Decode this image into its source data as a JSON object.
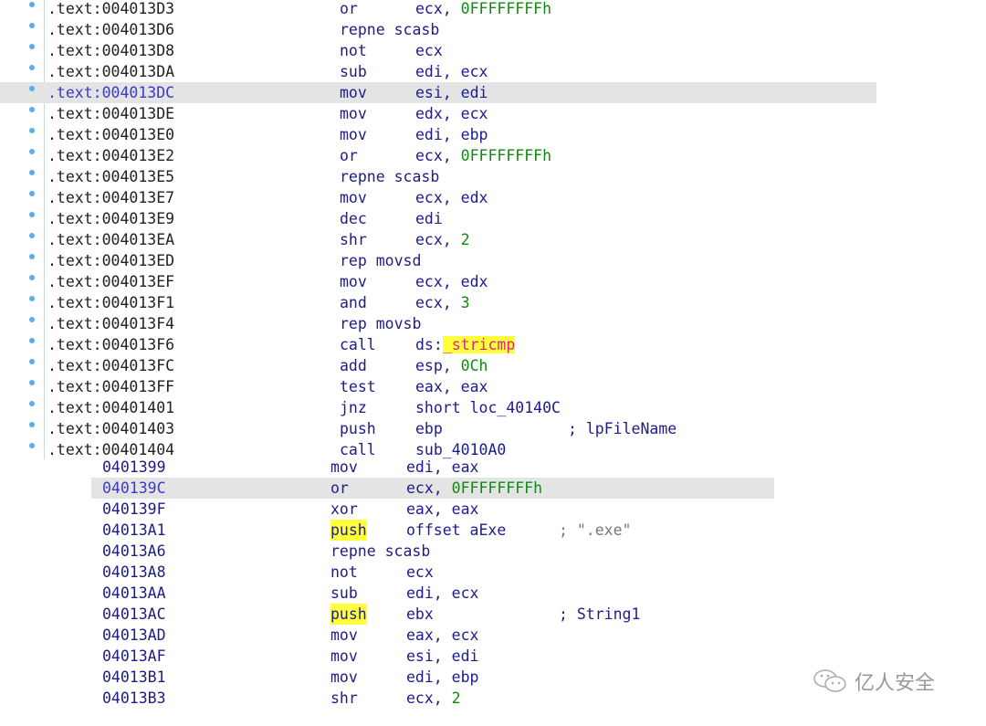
{
  "top_listing": [
    {
      "addr": ".text:004013D3",
      "mn": "or",
      "op": "ecx, ",
      "num": "0FFFFFFFFh",
      "partial": true
    },
    {
      "addr": ".text:004013D6",
      "mn": "repne scasb",
      "op": ""
    },
    {
      "addr": ".text:004013D8",
      "mn": "not",
      "op": "ecx"
    },
    {
      "addr": ".text:004013DA",
      "mn": "sub",
      "op": "edi, ecx"
    },
    {
      "addr": ".text:004013DC",
      "mn": "mov",
      "op": "esi, edi",
      "highlight": true
    },
    {
      "addr": ".text:004013DE",
      "mn": "mov",
      "op": "edx, ecx"
    },
    {
      "addr": ".text:004013E0",
      "mn": "mov",
      "op": "edi, ebp"
    },
    {
      "addr": ".text:004013E2",
      "mn": "or",
      "op": "ecx, ",
      "num": "0FFFFFFFFh"
    },
    {
      "addr": ".text:004013E5",
      "mn": "repne scasb",
      "op": ""
    },
    {
      "addr": ".text:004013E7",
      "mn": "mov",
      "op": "ecx, edx"
    },
    {
      "addr": ".text:004013E9",
      "mn": "dec",
      "op": "edi"
    },
    {
      "addr": ".text:004013EA",
      "mn": "shr",
      "op": "ecx, ",
      "num": "2"
    },
    {
      "addr": ".text:004013ED",
      "mn": "rep movsd",
      "op": ""
    },
    {
      "addr": ".text:004013EF",
      "mn": "mov",
      "op": "ecx, edx"
    },
    {
      "addr": ".text:004013F1",
      "mn": "and",
      "op": "ecx, ",
      "num": "3"
    },
    {
      "addr": ".text:004013F4",
      "mn": "rep movsb",
      "op": ""
    },
    {
      "addr": ".text:004013F6",
      "mn": "call",
      "op": "ds:",
      "fn": "_stricmp"
    },
    {
      "addr": ".text:004013FC",
      "mn": "add",
      "op": "esp, ",
      "num": "0Ch"
    },
    {
      "addr": ".text:004013FF",
      "mn": "test",
      "op": "eax, eax"
    },
    {
      "addr": ".text:00401401",
      "mn": "jnz",
      "op": "short loc_40140C"
    },
    {
      "addr": ".text:00401403",
      "mn": "push",
      "op": "ebp",
      "comment": "; lpFileName"
    },
    {
      "addr": ".text:00401404",
      "mn": "call",
      "op": "sub_4010A0"
    }
  ],
  "bottom_listing": [
    {
      "addr": "0401399",
      "mn": "mov",
      "op": "edi, eax",
      "partial": true
    },
    {
      "addr": "040139C",
      "mn": "or",
      "op": "ecx, ",
      "num": "0FFFFFFFFh",
      "highlight": true
    },
    {
      "addr": "040139F",
      "mn": "xor",
      "op": "eax, eax"
    },
    {
      "addr": "04013A1",
      "mn": "push",
      "op": "offset aExe",
      "comment": "; \".exe\"",
      "mark": true,
      "gray": true
    },
    {
      "addr": "04013A6",
      "mn": "repne scasb",
      "op": ""
    },
    {
      "addr": "04013A8",
      "mn": "not",
      "op": "ecx"
    },
    {
      "addr": "04013AA",
      "mn": "sub",
      "op": "edi, ecx"
    },
    {
      "addr": "04013AC",
      "mn": "push",
      "op": "ebx",
      "comment": "; String1",
      "mark": true
    },
    {
      "addr": "04013AD",
      "mn": "mov",
      "op": "eax, ecx"
    },
    {
      "addr": "04013AF",
      "mn": "mov",
      "op": "esi, edi"
    },
    {
      "addr": "04013B1",
      "mn": "mov",
      "op": "edi, ebp"
    },
    {
      "addr": "04013B3",
      "mn": "shr",
      "op": "ecx, ",
      "num": "2"
    }
  ],
  "watermark": {
    "text": "亿人安全",
    "icon": "wechat-icon"
  }
}
